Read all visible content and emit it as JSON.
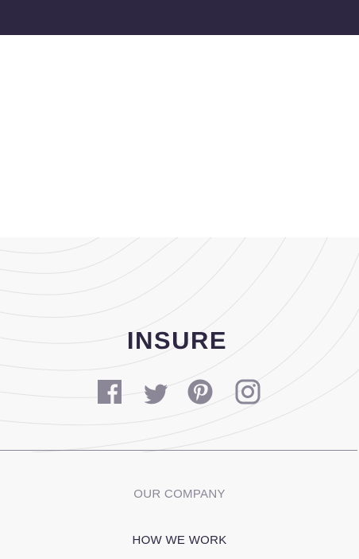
{
  "brand": {
    "logo_text": "INSURE"
  },
  "colors": {
    "header_bg": "#2e2742",
    "footer_bg": "#f8f8f8",
    "icon_gray": "#8b8797",
    "text_dark": "#2e2742"
  },
  "social": [
    {
      "name": "facebook",
      "icon": "facebook-icon"
    },
    {
      "name": "twitter",
      "icon": "twitter-icon"
    },
    {
      "name": "pinterest",
      "icon": "pinterest-icon"
    },
    {
      "name": "instagram",
      "icon": "instagram-icon"
    }
  ],
  "footer_nav": {
    "our_company": "OUR COMPANY",
    "how_we_work": "HOW WE WORK"
  }
}
